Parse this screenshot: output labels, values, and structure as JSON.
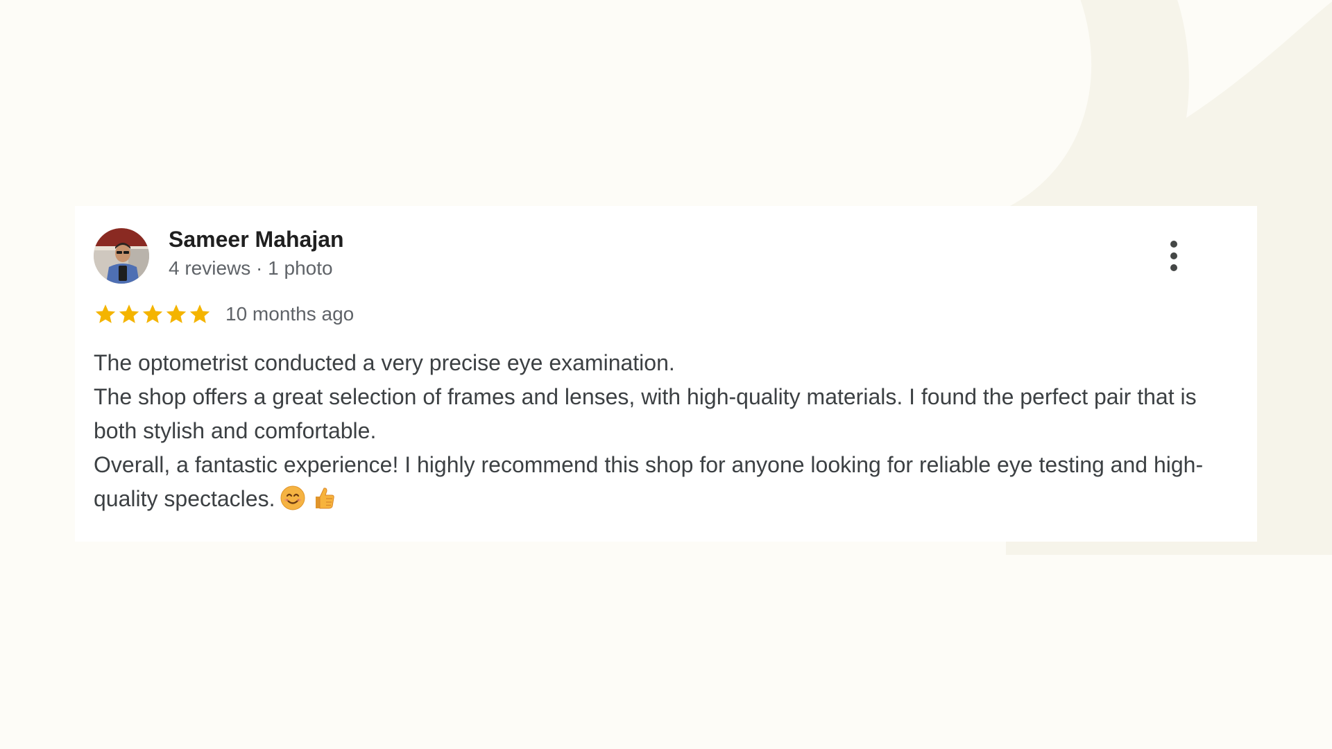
{
  "review": {
    "author_name": "Sameer Mahajan",
    "author_meta": "4 reviews · 1 photo",
    "rating": 5,
    "rating_max": 5,
    "time_ago": "10 months ago",
    "paragraphs": [
      "The optometrist conducted a very precise eye examination.",
      "The shop offers a great selection of frames and lenses, with high-quality materials. I found the perfect pair that is both stylish and comfortable.",
      "Overall, a fantastic experience! I highly recommend this shop for anyone looking for reliable eye testing and high-quality spectacles."
    ],
    "emojis": [
      "smiling-face-icon",
      "thumbs-up-icon"
    ]
  },
  "colors": {
    "star": "#f4b400",
    "page_background": "#fdfcf7",
    "card_background": "#ffffff",
    "decorative_shape": "#f6f4ea"
  }
}
